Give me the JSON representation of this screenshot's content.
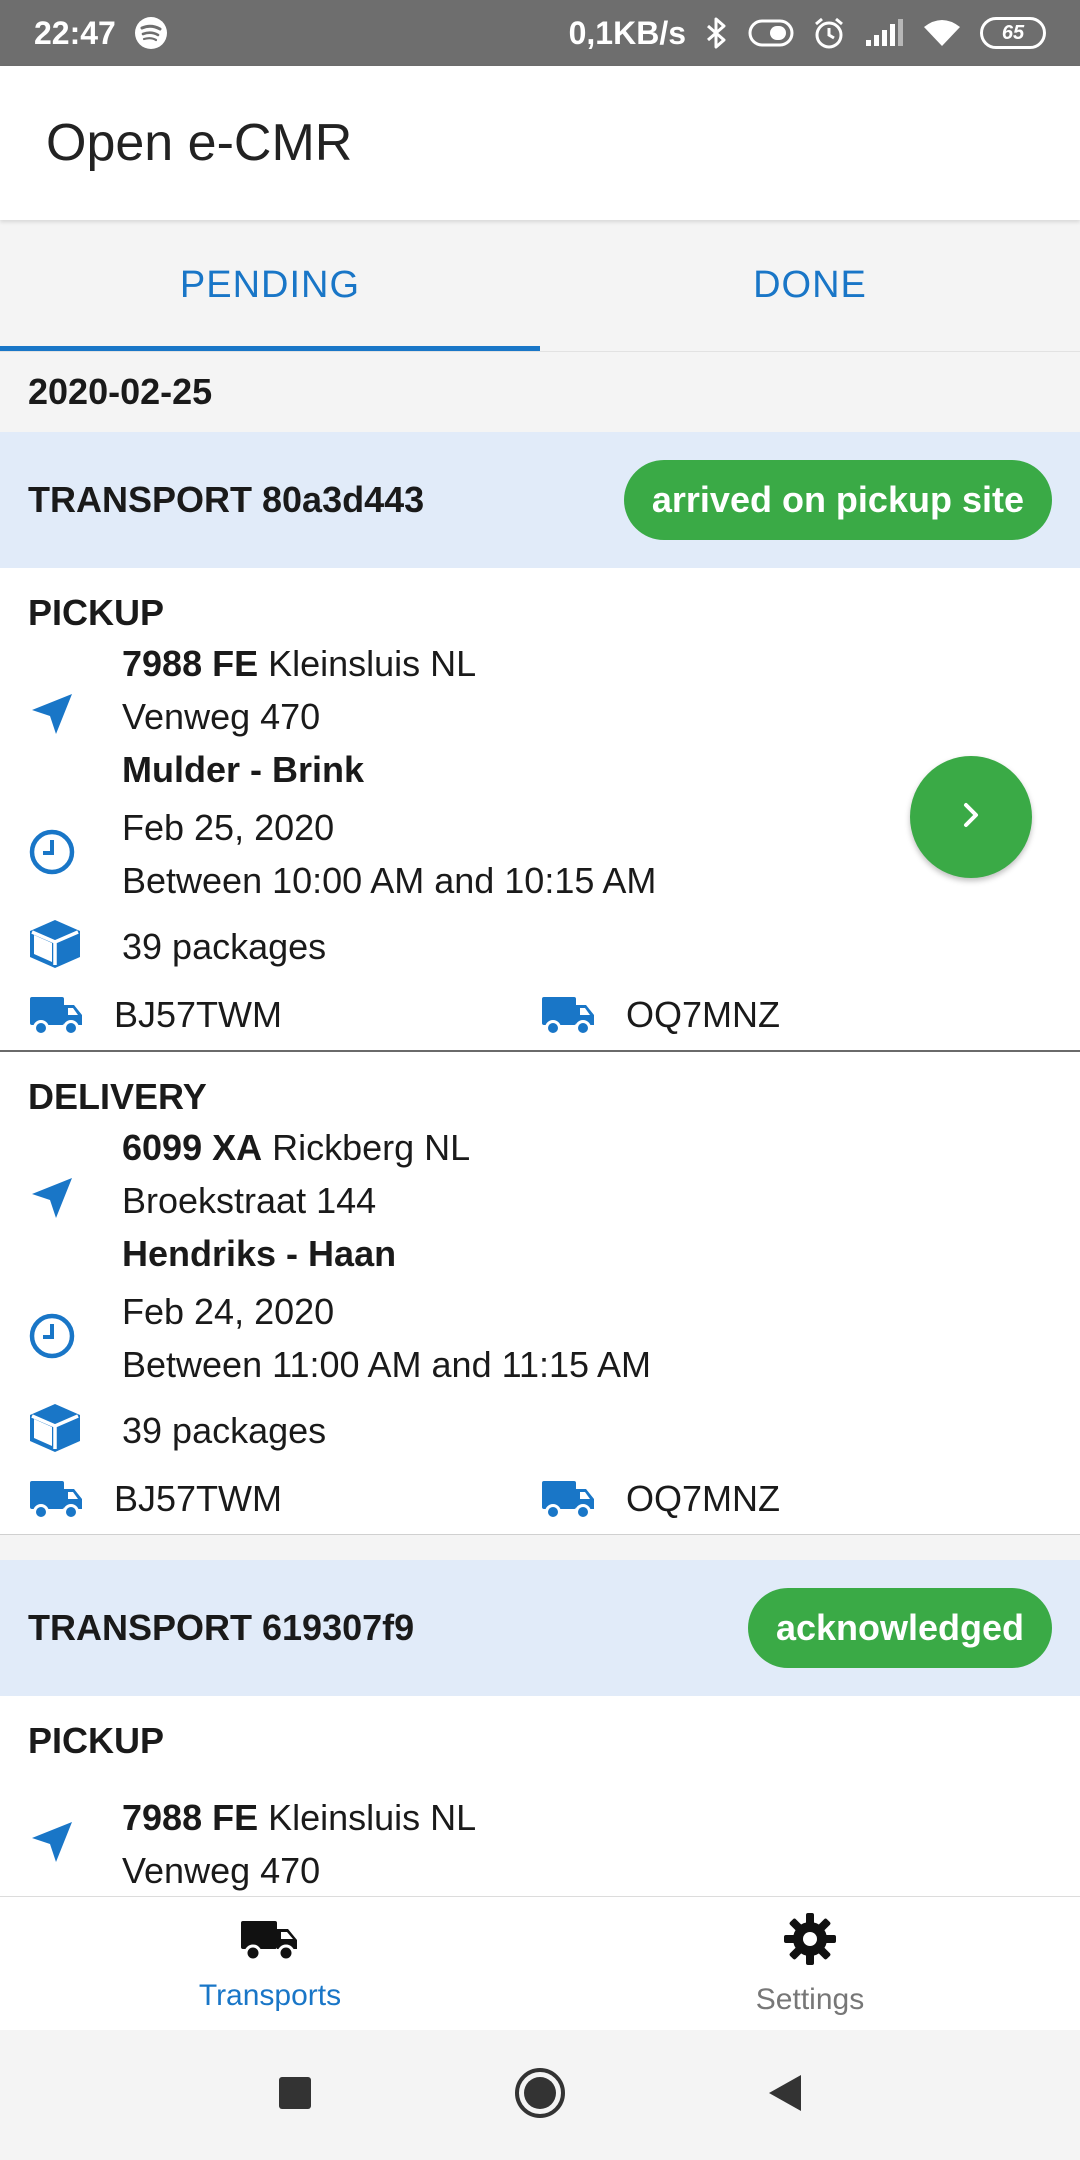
{
  "status_bar": {
    "time": "22:47",
    "net_speed": "0,1KB/s",
    "battery": "65",
    "icons": [
      "spotify-icon",
      "bluetooth-icon",
      "vibrate-icon",
      "alarm-icon",
      "signal-icon",
      "wifi-icon",
      "battery-icon"
    ]
  },
  "app_bar": {
    "title": "Open e-CMR"
  },
  "tabs": [
    {
      "label": "PENDING",
      "active": true
    },
    {
      "label": "DONE",
      "active": false
    }
  ],
  "date_group": "2020-02-25",
  "transports": [
    {
      "title": "TRANSPORT 80a3d443",
      "status": "arrived on pickup site",
      "pickup": {
        "heading": "PICKUP",
        "postcode": "7988 FE",
        "city": "Kleinsluis NL",
        "street": "Venweg 470",
        "company": "Mulder - Brink",
        "date": "Feb 25, 2020",
        "window": "Between 10:00 AM and 10:15 AM",
        "packages": "39 packages",
        "truck": "BJ57TWM",
        "trailer": "OQ7MNZ"
      },
      "delivery": {
        "heading": "DELIVERY",
        "postcode": "6099 XA",
        "city": "Rickberg NL",
        "street": "Broekstraat 144",
        "company": "Hendriks - Haan",
        "date": "Feb 24, 2020",
        "window": "Between 11:00 AM and 11:15 AM",
        "packages": "39 packages",
        "truck": "BJ57TWM",
        "trailer": "OQ7MNZ"
      }
    },
    {
      "title": "TRANSPORT 619307f9",
      "status": "acknowledged",
      "pickup": {
        "heading": "PICKUP",
        "postcode": "7988 FE",
        "city": "Kleinsluis NL",
        "street": "Venweg 470"
      }
    }
  ],
  "bottom_nav": [
    {
      "label": "Transports",
      "icon": "truck-icon",
      "active": true
    },
    {
      "label": "Settings",
      "icon": "gear-icon",
      "active": false
    }
  ],
  "colors": {
    "accent": "#1976c7",
    "status_green": "#3aaa46",
    "transport_header_bg": "#e1ebf9",
    "status_bar_bg": "#6e6e6e"
  }
}
